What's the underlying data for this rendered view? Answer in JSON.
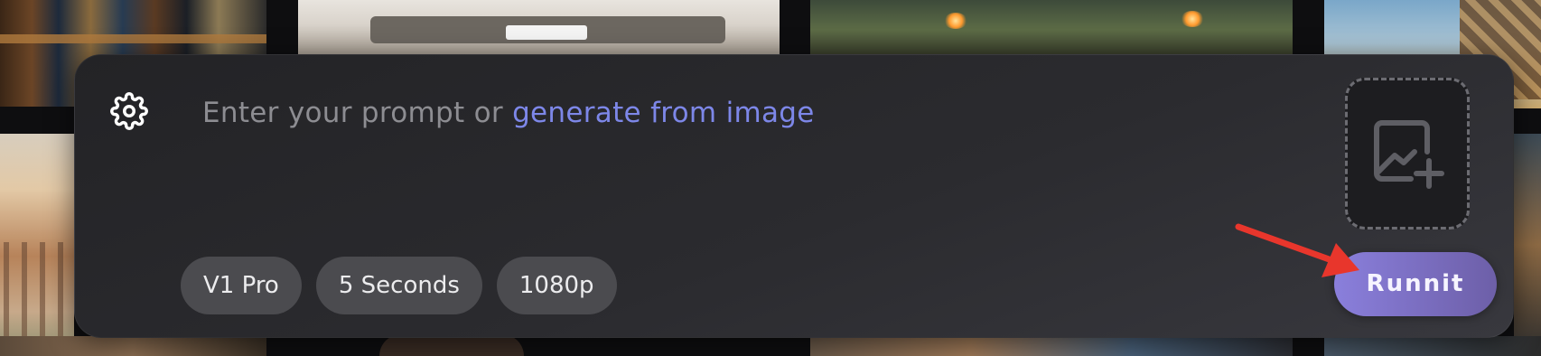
{
  "background": {
    "thumbnails": [
      {
        "name": "library-thumbnail"
      },
      {
        "name": "lounge-thumbnail"
      },
      {
        "name": "battle-thumbnail"
      },
      {
        "name": "sky-thumbnail"
      },
      {
        "name": "house-thumbnail"
      },
      {
        "name": "right-edge-thumbnail"
      }
    ]
  },
  "prompt_panel": {
    "settings_icon": "gear-icon",
    "placeholder_prefix": "Enter your prompt or ",
    "generate_link": "generate from image",
    "upload_icon": "image-plus-icon",
    "chips": [
      {
        "label": "V1 Pro"
      },
      {
        "label": "5 Seconds"
      },
      {
        "label": "1080p"
      }
    ],
    "run_button": "Runnit"
  },
  "colors": {
    "panel_bg": "#2b2b2f",
    "chip_bg": "#4b4b4f",
    "link": "#7d87e8",
    "run_start": "#8a7fdc",
    "run_end": "#6d5fa8",
    "annotation_arrow": "#e8362c"
  },
  "annotation": {
    "icon": "red-arrow-pointing-to-runnit"
  }
}
